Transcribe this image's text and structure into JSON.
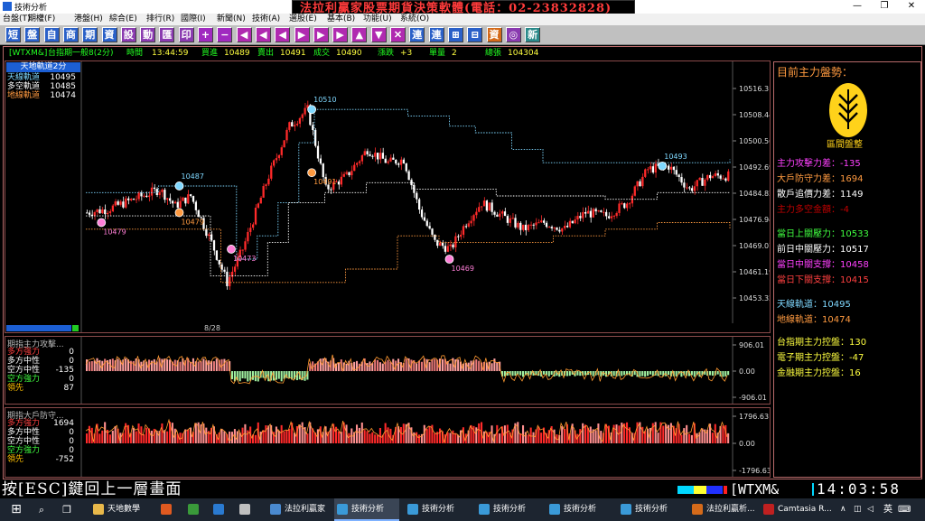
{
  "window": {
    "title": "技術分析",
    "banner": "法拉利贏家股票期貨決策軟體(電話：02-23832828)"
  },
  "menu": [
    "台盤(T)",
    "期權(F)",
    "港盤(H)",
    "綜合(E)",
    "排行(R)",
    "國際(I)",
    "新聞(N)",
    "技術(A)",
    "選股(E)",
    "基本(B)",
    "功能(U)",
    "系統(O)"
  ],
  "toolbar": {
    "buttons": [
      {
        "label": "短",
        "color": "#2a60c8"
      },
      {
        "label": "盤",
        "color": "#2a60c8"
      },
      {
        "label": "自",
        "color": "#2a60c8"
      },
      {
        "label": "商",
        "color": "#2a60c8"
      },
      {
        "label": "期",
        "color": "#2a60c8"
      },
      {
        "label": "資",
        "color": "#2a60c8"
      },
      {
        "label": "設",
        "color": "#8a3ab0"
      },
      {
        "label": "動",
        "color": "#8a3ab0"
      },
      {
        "label": "匯",
        "color": "#8a3ab0"
      },
      {
        "label": "印",
        "color": "#8a3ab0"
      },
      {
        "label": "+",
        "color": "#a02ac0"
      },
      {
        "label": "−",
        "color": "#a02ac0"
      },
      {
        "label": "◀",
        "color": "#b02ab0"
      },
      {
        "label": "◀",
        "color": "#b02ab0"
      },
      {
        "label": "◀",
        "color": "#b02ab0"
      },
      {
        "label": "▶",
        "color": "#b02ab0"
      },
      {
        "label": "▶",
        "color": "#b02ab0"
      },
      {
        "label": "▶",
        "color": "#b02ab0"
      },
      {
        "label": "▲",
        "color": "#b02ab0"
      },
      {
        "label": "▼",
        "color": "#b02ab0"
      },
      {
        "label": "✕",
        "color": "#b02ab0"
      },
      {
        "label": "連",
        "color": "#2a60c8"
      },
      {
        "label": "連",
        "color": "#2a60c8"
      },
      {
        "label": "⊞",
        "color": "#2a60c8"
      },
      {
        "label": "⊟",
        "color": "#2a60c8"
      },
      {
        "label": "資",
        "color": "#d46a1a"
      },
      {
        "label": "◎",
        "color": "#8a3ab0"
      },
      {
        "label": "新",
        "color": "#2a8a8a"
      }
    ]
  },
  "infobar": {
    "symbol": "[WTXM&]",
    "name": "台指期一般8(2分)",
    "time_label": "時間",
    "time": "13:44:59",
    "bid_label": "買進",
    "bid": "10489",
    "ask_label": "賣出",
    "ask": "10491",
    "deal_label": "成交",
    "deal": "10490",
    "change_label": "漲跌",
    "change": "+3",
    "lot_label": "單量",
    "lot": "2",
    "total_label": "總張",
    "total": "104304"
  },
  "main_panel": {
    "title": "天地軌道2分",
    "legend": [
      {
        "label": "天線軌道",
        "value": "10495",
        "color": "#7fd8ff"
      },
      {
        "label": "多空軌道",
        "value": "10485",
        "color": "#ffffff"
      },
      {
        "label": "地線軌道",
        "value": "10474",
        "color": "#ff9a40"
      }
    ],
    "date_label": "8/28",
    "yticks": [
      "10516.31",
      "10508.44",
      "10500.56",
      "10492.69",
      "10484.82",
      "10476.94",
      "10469.07",
      "10461.19",
      "10453.32"
    ],
    "markers": [
      {
        "text": "10510",
        "color": "#7fd8ff"
      },
      {
        "text": "10487",
        "color": "#7fd8ff"
      },
      {
        "text": "10493",
        "color": "#7fd8ff"
      },
      {
        "text": "10479",
        "color": "#ff9a40"
      },
      {
        "text": "10491",
        "color": "#ff9a40"
      },
      {
        "text": "10479",
        "color": "#ff7fd8"
      },
      {
        "text": "10473",
        "color": "#ff7fd8"
      },
      {
        "text": "10469",
        "color": "#ff7fd8"
      }
    ]
  },
  "panel2": {
    "title": "期指主力攻擊...",
    "legend": [
      {
        "label": "多方強力",
        "value": "0",
        "color": "#ff4040"
      },
      {
        "label": "多方中性",
        "value": "0",
        "color": "#ffffff"
      },
      {
        "label": "空方中性",
        "value": "-135",
        "color": "#ffffff"
      },
      {
        "label": "空方強力",
        "value": "0",
        "color": "#40ff40"
      },
      {
        "label": "領先",
        "value": "87",
        "color": "#ffc000"
      }
    ],
    "yticks": [
      "906.01",
      "0.00",
      "-906.01"
    ]
  },
  "panel3": {
    "title": "期指大戶防守...",
    "legend": [
      {
        "label": "多方強力",
        "value": "1694",
        "color": "#ff4040"
      },
      {
        "label": "多方中性",
        "value": "0",
        "color": "#ffffff"
      },
      {
        "label": "空方中性",
        "value": "0",
        "color": "#ffffff"
      },
      {
        "label": "空方強力",
        "value": "0",
        "color": "#40ff40"
      },
      {
        "label": "領先",
        "value": "-752",
        "color": "#ffc000"
      }
    ],
    "yticks": [
      "1796.63",
      "0.00",
      "-1796.63"
    ]
  },
  "side": {
    "heading": "目前主力盤勢：",
    "logo_caption": "區間盤整",
    "lines_a": [
      {
        "text": "主力攻擊力差：-135",
        "color": "#ff40ff"
      },
      {
        "text": "大戶防守力差：1694",
        "color": "#ff9a40"
      },
      {
        "text": "散戶追價力差：1149",
        "color": "#ffffff"
      },
      {
        "text": "主力多空金額：-4",
        "color": "#c00000"
      }
    ],
    "lines_b": [
      {
        "text": "當日上關壓力：10533",
        "color": "#40ff40"
      },
      {
        "text": "前日中關壓力：10517",
        "color": "#ffffff"
      },
      {
        "text": "當日中關支撐：10458",
        "color": "#ff40ff"
      },
      {
        "text": "當日下關支撐：10415",
        "color": "#ff4040"
      }
    ],
    "lines_c": [
      {
        "text": "天線軌道：10495",
        "color": "#7fd8ff"
      },
      {
        "text": "地線軌道：10474",
        "color": "#ff9a40"
      }
    ],
    "lines_d": [
      {
        "text": "台指期主力控盤：130",
        "color": "#ffff40"
      },
      {
        "text": "電子期主力控盤：-47",
        "color": "#ffff40"
      },
      {
        "text": "金融期主力控盤：16",
        "color": "#ffff40"
      }
    ]
  },
  "status": {
    "esc_hint": "按[ESC]鍵回上一層畫面",
    "symbol": "[WTXM&",
    "clock": "14:03:58"
  },
  "taskbar": {
    "items": [
      {
        "label": "天地數學",
        "color": "#e8b84a"
      },
      {
        "label": "",
        "color": "#e05a20"
      },
      {
        "label": "",
        "color": "#3a9a3a"
      },
      {
        "label": "",
        "color": "#2a7ad0"
      },
      {
        "label": "",
        "color": "#c0c0c0"
      },
      {
        "label": "法拉利贏家",
        "color": "#4a8ad0"
      },
      {
        "label": "技術分析",
        "color": "#3a9ad8"
      },
      {
        "label": "技術分析",
        "color": "#3a9ad8"
      },
      {
        "label": "技術分析",
        "color": "#3a9ad8"
      },
      {
        "label": "技術分析",
        "color": "#3a9ad8"
      },
      {
        "label": "技術分析",
        "color": "#3a9ad8"
      },
      {
        "label": "法拉利贏析...",
        "color": "#d46a1a"
      },
      {
        "label": "Camtasia R...",
        "color": "#c02020"
      }
    ],
    "ime": "英"
  }
}
